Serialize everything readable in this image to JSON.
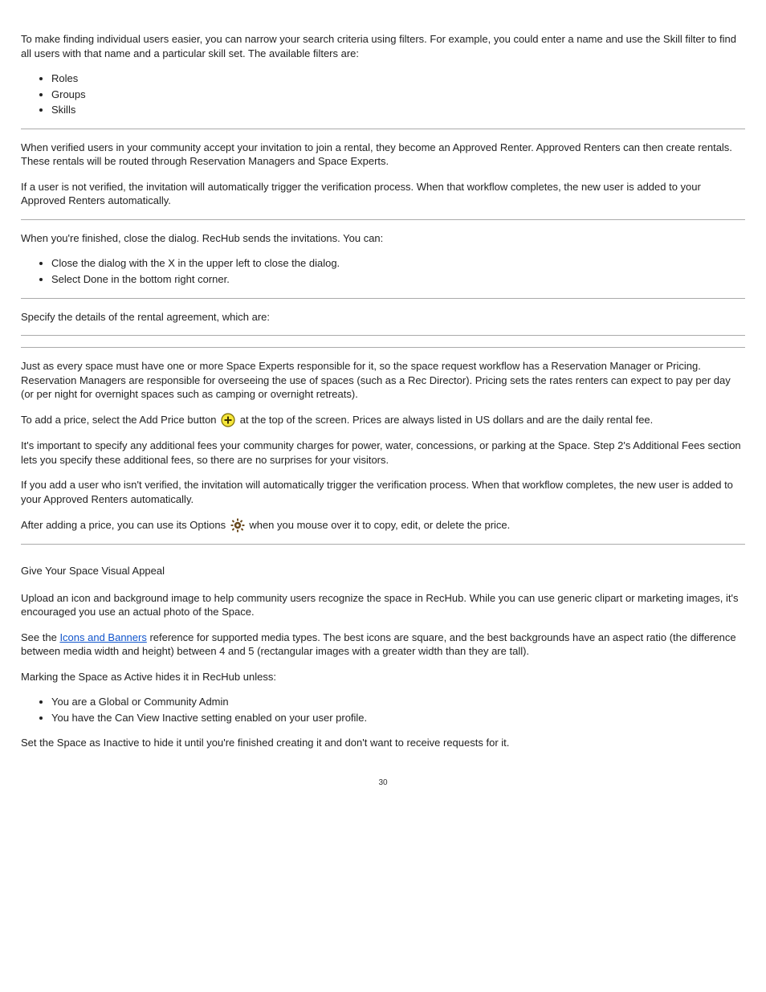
{
  "intro": {
    "p1": "To make finding individual users easier, you can narrow your search criteria using filters. For example, you could enter a name and use the Skill filter to find all users with that name and a particular skill set. The available filters are:"
  },
  "filters": {
    "items": [
      "Roles",
      "Groups",
      "Skills"
    ]
  },
  "afterFilters": {
    "p1": "When verified users in your community accept your invitation to join a rental, they become an Approved Renter. Approved Renters can then create rentals. These rentals will be routed through Reservation Managers and Space Experts.",
    "p2": "If a user is not verified, the invitation will automatically trigger the verification process. When that workflow completes, the new user is added to your Approved Renters automatically."
  },
  "closeDialog": {
    "p1": "When you're finished, close the dialog. RecHub sends the invitations. You can:"
  },
  "closeList": {
    "items": [
      "Close the dialog with the X in the upper left to close the dialog.",
      "Select Done in the bottom right corner."
    ]
  },
  "pricingEmpty": {
    "p1": "Specify the details of the rental agreement, which are:"
  },
  "pricingDetails": {
    "p1": "Just as every space must have one or more Space Experts responsible for it, so the space request workflow has a Reservation Manager or Pricing. Reservation Managers are responsible for overseeing the use of spaces (such as a Rec Director). Pricing sets the rates renters can expect to pay per day (or per night for overnight spaces such as camping or overnight retreats).",
    "p2_before_icon": "To add a price, select the Add Price button ",
    "p2_after_icon": " at the top of the screen. Prices are always listed in US dollars and are the daily rental fee.",
    "p3": "It's important to specify any additional fees your community charges for power, water, concessions, or parking at the Space. Step 2's Additional Fees section lets you specify these additional fees, so there are no surprises for your visitors.",
    "p4": "If you add a user who isn't verified, the invitation will automatically trigger the verification process. When that workflow completes, the new user is added to your Approved Renters automatically.",
    "p5_before_icon": "After adding a price, you can use its Options ",
    "p5_after_icon": " when you mouse over it to copy, edit, or delete the price."
  },
  "visual": {
    "heading": "Give Your Space Visual Appeal",
    "p1": "Upload an icon and background image to help community users recognize the space in RecHub. While you can use generic clipart or marketing images, it's encouraged you use an actual photo of the Space.",
    "link_text": "Icons and Banners",
    "p2_before_link": "See the ",
    "p2_after_link": " reference for supported media types. The best icons are square, and the best backgrounds have an aspect ratio (the difference between media width and height) between 4 and 5 (rectangular images with a greater width than they are tall).",
    "p3": "Marking the Space as Active hides it in RecHub unless:"
  },
  "visualList": {
    "items": [
      "You are a Global or Community Admin",
      "You have the Can View Inactive setting enabled on your user profile."
    ]
  },
  "final": {
    "p1": "Set the Space as Inactive to hide it until you're finished creating it and don't want to receive requests for it."
  },
  "pageNumber": "30"
}
